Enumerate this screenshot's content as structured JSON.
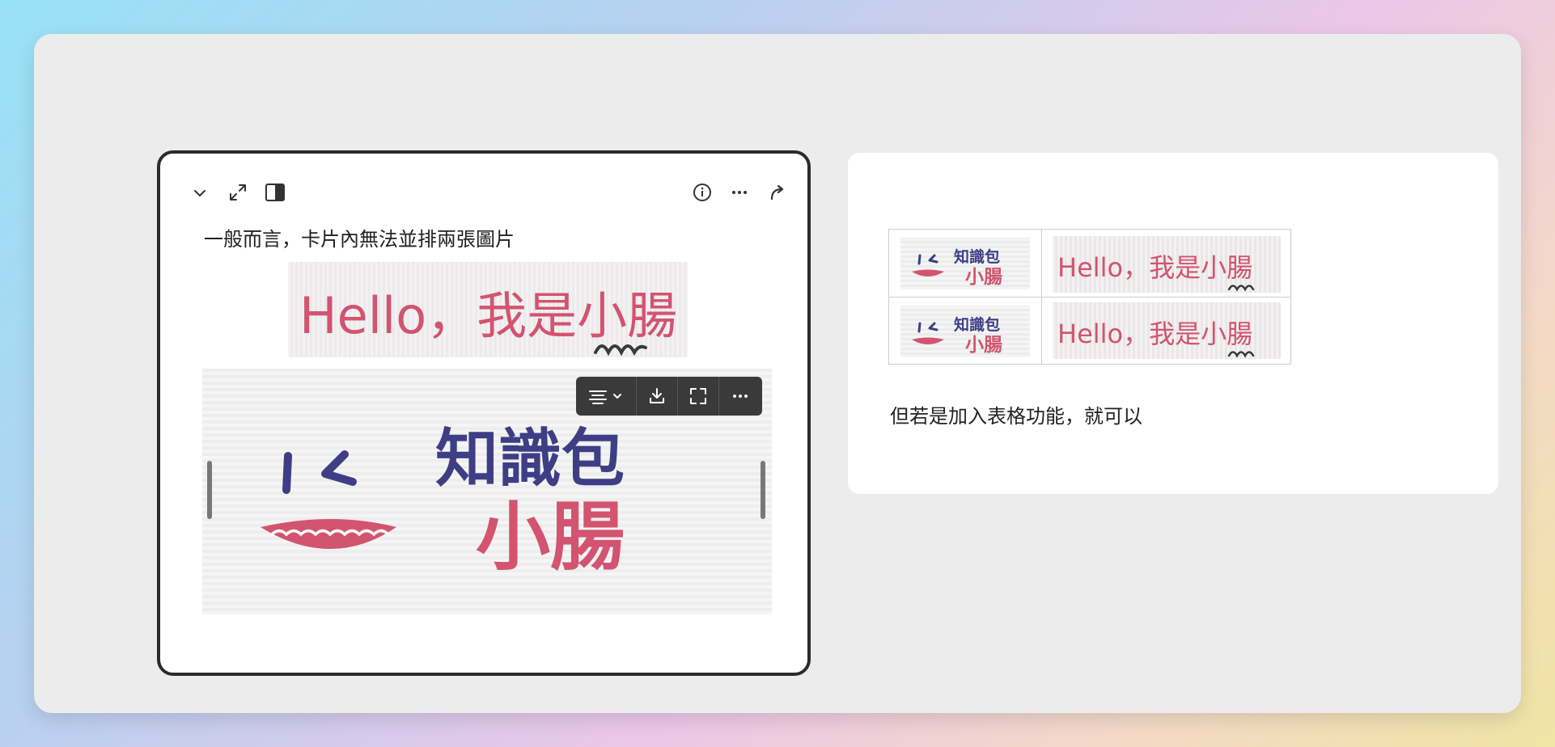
{
  "left_card": {
    "text": "一般而言，卡片內無法並排兩張圖片",
    "hello_image": {
      "text": "Hello，我是小腸"
    },
    "logo_image": {
      "line1": "知識包",
      "line2": "小腸"
    }
  },
  "right_panel": {
    "text": "但若是加入表格功能，就可以",
    "table_cells": [
      {
        "line1": "知識包",
        "line2": "小腸"
      },
      {
        "text": "Hello，我是小腸"
      },
      {
        "line1": "知識包",
        "line2": "小腸"
      },
      {
        "text": "Hello，我是小腸"
      }
    ]
  },
  "colors": {
    "pink": "#d2546f",
    "navy": "#3e3e86",
    "border": "#2b2b2b"
  }
}
